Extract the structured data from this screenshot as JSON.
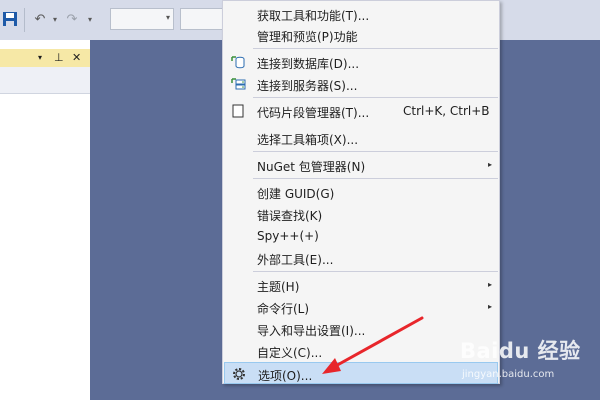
{
  "toolbar": {
    "save_icon": "save-icon",
    "undo_icon": "undo-icon",
    "redo_icon": "redo-icon",
    "dropdown_glyph": "▾"
  },
  "tool_window": {
    "header_buttons": {
      "dropdown": "▾",
      "pin": "⊥",
      "close": "✕"
    },
    "header_color": "#f6e8a6"
  },
  "menu": {
    "items": [
      {
        "label": "获取工具和功能(T)...",
        "icon": null
      },
      {
        "label": "管理和预览(P)功能",
        "icon": null
      },
      {
        "label": "连接到数据库(D)...",
        "icon": "database-connect-icon"
      },
      {
        "label": "连接到服务器(S)...",
        "icon": "server-connect-icon"
      },
      {
        "label": "代码片段管理器(T)...",
        "icon": "code-snippet-icon",
        "shortcut": "Ctrl+K, Ctrl+B"
      },
      {
        "label": "选择工具箱项(X)...",
        "icon": null
      },
      {
        "label": "NuGet 包管理器(N)",
        "icon": null,
        "submenu": true
      },
      {
        "label": "创建 GUID(G)",
        "icon": null
      },
      {
        "label": "错误查找(K)",
        "icon": null
      },
      {
        "label": "Spy++(+)",
        "icon": null
      },
      {
        "label": "外部工具(E)...",
        "icon": null
      },
      {
        "label": "主题(H)",
        "icon": null,
        "submenu": true
      },
      {
        "label": "命令行(L)",
        "icon": null,
        "submenu": true
      },
      {
        "label": "导入和导出设置(I)...",
        "icon": null
      },
      {
        "label": "自定义(C)...",
        "icon": null
      },
      {
        "label": "选项(O)...",
        "icon": "gear-icon",
        "highlighted": true
      }
    ],
    "submenu_arrow": "▸"
  },
  "annotation": {
    "color": "#e8262b"
  },
  "watermark": {
    "main": "Baidu 经验",
    "sub": "jingyan.baidu.com"
  },
  "colors": {
    "background": "#5c6c96",
    "menu_bg": "#f5f5f5",
    "highlight": "#c9def5"
  }
}
